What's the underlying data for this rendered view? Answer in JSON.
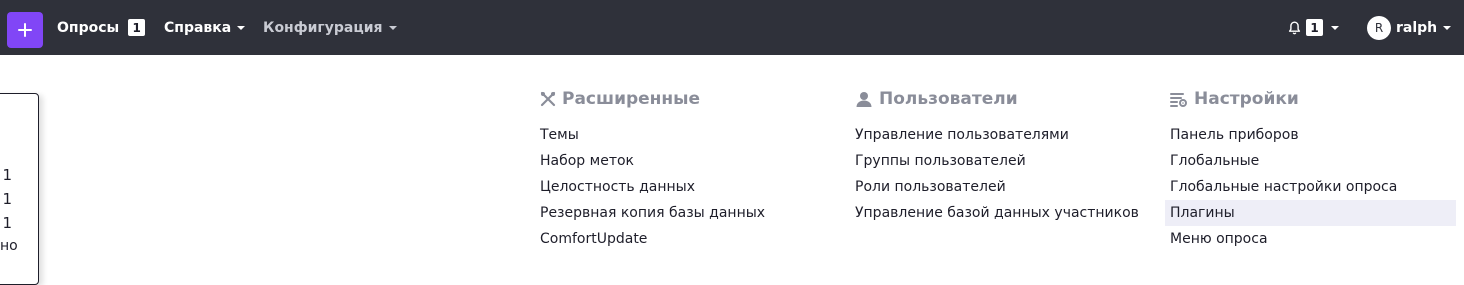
{
  "topbar": {
    "add_icon": "plus-icon",
    "nav": [
      {
        "label": "Опросы",
        "badge": "1"
      },
      {
        "label": "Справка"
      },
      {
        "label": "Конфигурация"
      }
    ],
    "notifications": {
      "icon": "bell-icon",
      "count": "1"
    },
    "user": {
      "initial": "R",
      "name": "ralph"
    }
  },
  "left_panel": {
    "values": [
      "1",
      "1",
      "1"
    ],
    "tail": "но"
  },
  "menu": {
    "columns": [
      {
        "icon": "tools-icon",
        "title": "Расширенные",
        "items": [
          "Темы",
          "Набор меток",
          "Целостность данных",
          "Резервная копия базы данных",
          "ComfortUpdate"
        ]
      },
      {
        "icon": "user-icon",
        "title": "Пользователи",
        "items": [
          "Управление пользователями",
          "Группы пользователей",
          "Роли пользователей",
          "Управление базой данных участников"
        ]
      },
      {
        "icon": "settings-list-icon",
        "title": "Настройки",
        "items": [
          "Панель приборов",
          "Глобальные",
          "Глобальные настройки опроса",
          "Плагины",
          "Меню опроса"
        ],
        "highlighted": "Плагины"
      }
    ]
  },
  "colors": {
    "topbar": "#2f313a",
    "accent": "#8146f6",
    "heading": "#8a8d99",
    "highlight": "#eeeef7"
  }
}
